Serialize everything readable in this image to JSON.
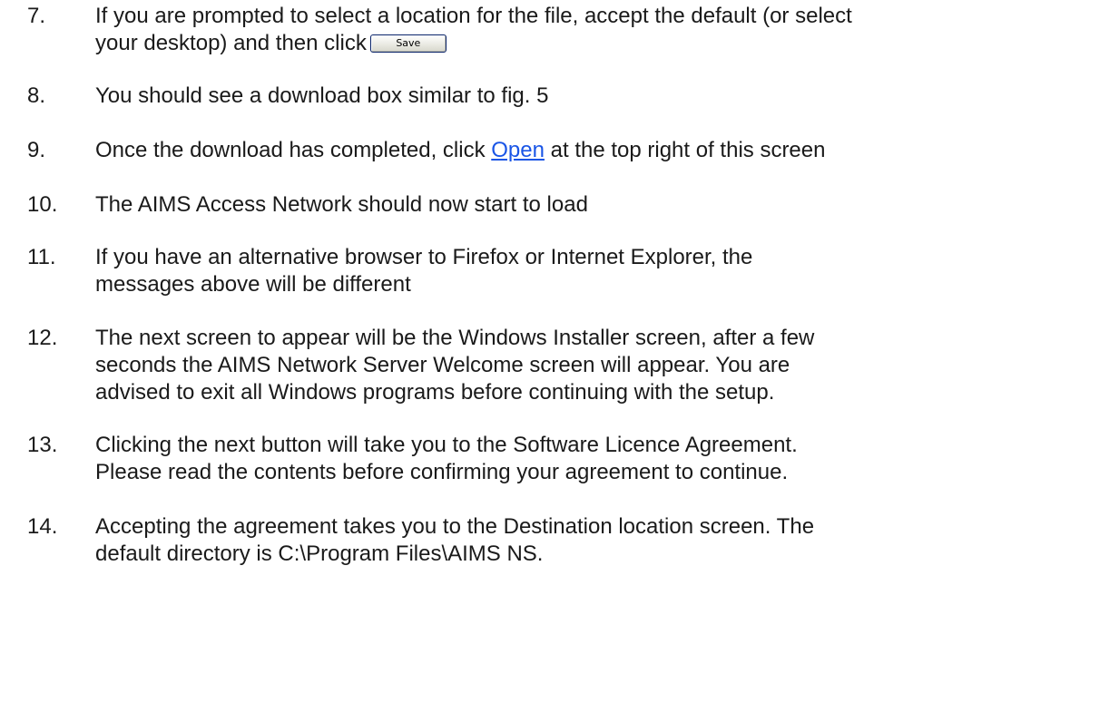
{
  "steps": [
    {
      "number": "7.",
      "line1": "If you are prompted to select a location for the file, accept the default (or select",
      "line2_pre": "your desktop) and then click",
      "button_label": "Save"
    },
    {
      "number": "8.",
      "text": "You should see a download box similar to fig. 5"
    },
    {
      "number": "9.",
      "text_pre": "Once the download has completed, click ",
      "link_text": "Open",
      "text_post": " at the top right of this screen"
    },
    {
      "number": "10.",
      "text": "The AIMS Access Network should now start to load"
    },
    {
      "number": "11.",
      "line1": "If you have an alternative browser to Firefox or Internet Explorer, the",
      "line2": "messages above will be different"
    },
    {
      "number": "12.",
      "line1": "The next screen to appear will be the Windows Installer screen, after a few",
      "line2": "seconds the AIMS Network Server Welcome screen will appear. You are",
      "line3": "advised to exit all Windows programs before continuing with the setup."
    },
    {
      "number": "13.",
      "line1": "Clicking the next button will take you to the Software Licence Agreement.",
      "line2": "Please read the contents before confirming your agreement to continue."
    },
    {
      "number": "14.",
      "line1": "Accepting the agreement takes you to the Destination location screen. The",
      "line2": "default directory is C:\\Program Files\\AIMS NS."
    }
  ]
}
